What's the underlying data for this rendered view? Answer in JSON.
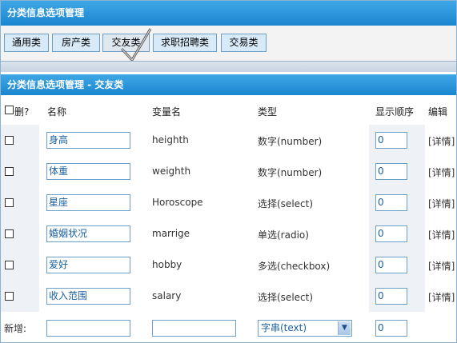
{
  "window": {
    "title": "分类信息选项管理"
  },
  "tabs": [
    {
      "label": "通用类"
    },
    {
      "label": "房产类"
    },
    {
      "label": "交友类",
      "active": true
    },
    {
      "label": "求职招聘类"
    },
    {
      "label": "交易类"
    }
  ],
  "section": {
    "title": "分类信息选项管理 - 交友类"
  },
  "table": {
    "columns": {
      "delete": "删?",
      "name": "名称",
      "variable": "变量名",
      "type": "类型",
      "order": "显示顺序",
      "edit": "编辑"
    },
    "rows": [
      {
        "name": "身高",
        "variable": "heighth",
        "type": "数字(number)",
        "order": "0",
        "edit": "[详情]"
      },
      {
        "name": "体重",
        "variable": "weighth",
        "type": "数字(number)",
        "order": "0",
        "edit": "[详情]"
      },
      {
        "name": "星座",
        "variable": "Horoscope",
        "type": "选择(select)",
        "order": "0",
        "edit": "[详情]"
      },
      {
        "name": "婚姻状况",
        "variable": "marrige",
        "type": "单选(radio)",
        "order": "0",
        "edit": "[详情]"
      },
      {
        "name": "爱好",
        "variable": "hobby",
        "type": "多选(checkbox)",
        "order": "0",
        "edit": "[详情]"
      },
      {
        "name": "收入范围",
        "variable": "salary",
        "type": "选择(select)",
        "order": "0",
        "edit": "[详情]"
      }
    ],
    "new_row": {
      "label": "新增:",
      "name_value": "",
      "variable_value": "",
      "type_selected": "字串(text)",
      "order": "0"
    }
  },
  "colors": {
    "header_blue": "#1a86cf",
    "tab_bg": "#d8eaf8",
    "tab_border": "#6c9fc7",
    "input_text": "#1a5fa0"
  },
  "icons": {
    "active_tab_marker": "check-mark-icon",
    "select_arrow": "chevron-down-icon"
  }
}
